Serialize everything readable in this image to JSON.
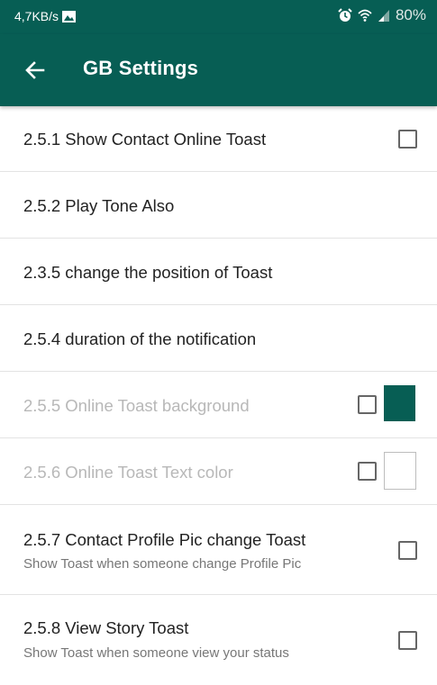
{
  "status_bar": {
    "speed": "4,7KB/s",
    "battery": "80%"
  },
  "app_bar": {
    "title": "GB Settings"
  },
  "settings": [
    {
      "title": "2.5.1 Show Contact Online Toast",
      "checked": false
    },
    {
      "title": "2.5.2 Play Tone Also"
    },
    {
      "title": "2.3.5 change the position of Toast"
    },
    {
      "title": "2.5.4 duration of the notification"
    },
    {
      "title": "2.5.5 Online Toast background",
      "enabled": false,
      "checked": false,
      "color": "#075e54"
    },
    {
      "title": "2.5.6 Online Toast Text color",
      "enabled": false,
      "checked": false,
      "color": "#ffffff"
    },
    {
      "title": "2.5.7 Contact Profile Pic change Toast",
      "subtitle": "Show Toast when someone change Profile Pic",
      "checked": false
    },
    {
      "title": "2.5.8 View Story Toast",
      "subtitle": "Show Toast when someone view your status",
      "checked": false
    }
  ],
  "colors": {
    "primary": "#075e54",
    "divider": "#e3e3e3"
  }
}
